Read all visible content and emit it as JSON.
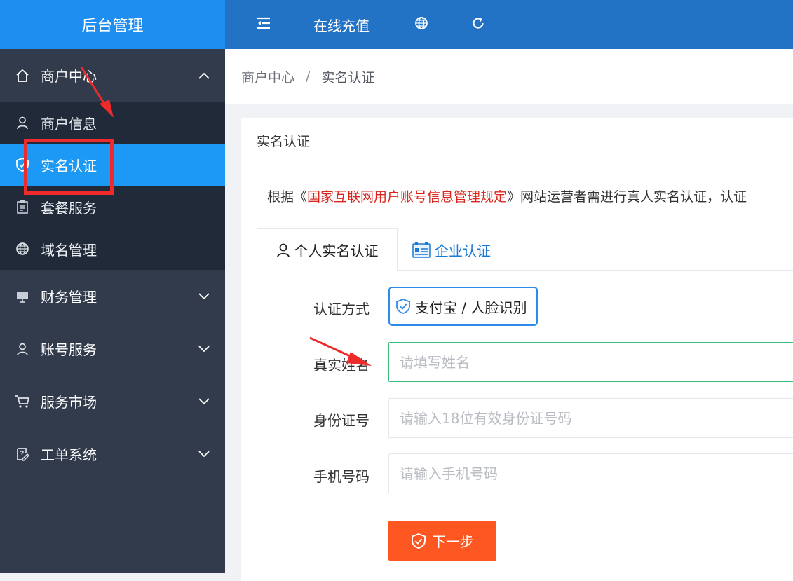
{
  "app": {
    "title": "后台管理"
  },
  "header": {
    "recharge_label": "在线充值",
    "menu_toggle_icon": "menu-fold-icon",
    "globe_icon": "globe-icon",
    "refresh_icon": "refresh-icon"
  },
  "sidebar": {
    "groups": [
      {
        "label": "商户中心",
        "icon": "home-icon",
        "expanded": true,
        "items": [
          {
            "label": "商户信息",
            "icon": "user-icon"
          },
          {
            "label": "实名认证",
            "icon": "shield-check-icon",
            "active": true
          },
          {
            "label": "套餐服务",
            "icon": "clipboard-icon"
          },
          {
            "label": "域名管理",
            "icon": "globe-icon"
          }
        ]
      },
      {
        "label": "财务管理",
        "icon": "monitor-icon"
      },
      {
        "label": "账号服务",
        "icon": "user-icon"
      },
      {
        "label": "服务市场",
        "icon": "cart-icon"
      },
      {
        "label": "工单系统",
        "icon": "ticket-icon"
      }
    ]
  },
  "breadcrumb": {
    "parent": "商户中心",
    "separator": "/",
    "current": "实名认证"
  },
  "card": {
    "title": "实名认证",
    "notice": {
      "prefix": "根据《",
      "law": "国家互联网用户账号信息管理规定",
      "suffix": "》网站运营者需进行真人实名认证，认证"
    },
    "tabs": [
      {
        "label": "个人实名认证",
        "icon": "user-icon",
        "active": true
      },
      {
        "label": "企业认证",
        "icon": "business-card-icon"
      }
    ],
    "form": {
      "method_label": "认证方式",
      "method_value": "支付宝 / 人脸识别",
      "name_label": "真实姓名",
      "name_placeholder": "请填写姓名",
      "id_label": "身份证号",
      "id_placeholder": "请输入18位有效身份证号码",
      "phone_label": "手机号码",
      "phone_placeholder": "请输入手机号码",
      "next_label": "下一步"
    }
  },
  "colors": {
    "sidebar_bg": "#313b4c",
    "submenu_bg": "#212a38",
    "active_item": "#1c98f5",
    "logo_bg": "#1e8ef0",
    "header_bg": "#2272c6",
    "law_text": "#d9271f",
    "next_button": "#ff5722",
    "annotation": "#ee2b2b"
  }
}
